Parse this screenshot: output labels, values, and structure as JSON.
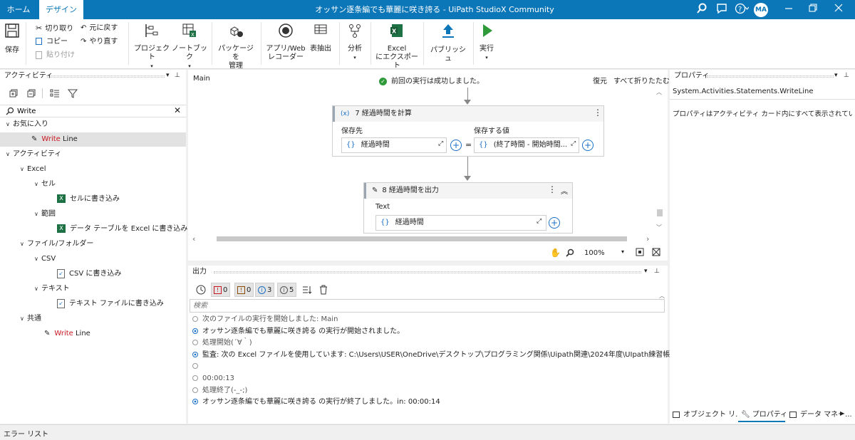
{
  "titlebar": {
    "tab_home": "ホーム",
    "tab_design": "デザイン",
    "title": "オッサン逐条編でも華麗に咲き誇る - UiPath StudioX Community",
    "avatar": "MA",
    "accent": "#0b76b8"
  },
  "ribbon": {
    "save": "保存",
    "cut": "切り取り",
    "copy": "コピー",
    "paste": "貼り付け",
    "undo": "元に戻す",
    "redo": "やり直す",
    "project": "プロジェクト",
    "notebook": "ノートブック",
    "package_l1": "パッケージを",
    "package_l2": "管理",
    "recorder_l1": "アプリ/Web",
    "recorder_l2": "レコーダー",
    "table_extract": "表抽出",
    "analyze": "分析",
    "excel_l1": "Excel",
    "excel_l2": "にエクスポート",
    "publish": "パブリッシュ",
    "run": "実行"
  },
  "activities": {
    "title": "アクティビティ",
    "search_value": "Write",
    "tree": [
      {
        "label": "お気に入り",
        "indent": 0,
        "type": "group"
      },
      {
        "label_red": "Write",
        "label_rest": " Line",
        "indent": 2,
        "type": "item",
        "selected": true
      },
      {
        "label": "アクティビティ",
        "indent": 0,
        "type": "group"
      },
      {
        "label": "Excel",
        "indent": 1,
        "type": "group"
      },
      {
        "label": "セル",
        "indent": 2,
        "type": "group"
      },
      {
        "label": "セルに書き込み",
        "indent": 3,
        "type": "excel"
      },
      {
        "label": "範囲",
        "indent": 2,
        "type": "group"
      },
      {
        "label": "データ テーブルを Excel に書き込み",
        "indent": 3,
        "type": "excel"
      },
      {
        "label": "ファイル/フォルダー",
        "indent": 1,
        "type": "group"
      },
      {
        "label": "CSV",
        "indent": 2,
        "type": "group"
      },
      {
        "label": "CSV に書き込み",
        "indent": 3,
        "type": "file"
      },
      {
        "label": "テキスト",
        "indent": 2,
        "type": "group"
      },
      {
        "label": "テキスト ファイルに書き込み",
        "indent": 3,
        "type": "file"
      },
      {
        "label": "共通",
        "indent": 1,
        "type": "group"
      },
      {
        "label_red": "Write",
        "label_rest": " Line",
        "indent": 3,
        "type": "item"
      }
    ]
  },
  "designer": {
    "breadcrumb": "Main",
    "status": "前回の実行は成功しました。",
    "restore": "復元",
    "collapse_all": "すべて折りたたむ",
    "card1": {
      "title": "7 経過時間を計算",
      "save_to_label": "保存先",
      "value_label": "保存する値",
      "save_to_value": "経過時間",
      "value_value": "(終了時間 - 開始時間..."
    },
    "card2": {
      "title": "8 経過時間を出力",
      "text_label": "Text",
      "text_value": "経過時間"
    },
    "zoom": "100%"
  },
  "output": {
    "title": "出力",
    "filters": [
      {
        "icon": "!",
        "count": "0",
        "color": "#c8161e"
      },
      {
        "icon": "!",
        "count": "0",
        "color": "#8a4b00"
      },
      {
        "icon": "i",
        "count": "3",
        "color": "#1a6fc6"
      },
      {
        "icon": "i",
        "count": "5",
        "color": "#555555"
      }
    ],
    "search_placeholder": "検索",
    "lines": [
      {
        "text": "次のファイルの実行を開始しました: Main",
        "kind": "trace"
      },
      {
        "text": "オッサン逐条編でも華麗に咲き誇る の実行が開始されました。",
        "kind": "info"
      },
      {
        "text": "処理開始(´∀｀)",
        "kind": "trace"
      },
      {
        "text": "監査: 次の Excel ファイルを使用しています: C:\\Users\\USER\\OneDrive\\デスクトップ\\プログラミング関係\\Uipath関連\\2024年度\\UIpath練習帳.xlsx",
        "kind": "info"
      },
      {
        "text": "",
        "kind": "trace"
      },
      {
        "text": "00:00:13",
        "kind": "trace"
      },
      {
        "text": "処理終了(-_-;)",
        "kind": "trace"
      },
      {
        "text": "オッサン逐条編でも華麗に咲き誇る の実行が終了しました。in: 00:00:14",
        "kind": "info"
      }
    ]
  },
  "properties": {
    "title": "プロパティ",
    "class_name": "System.Activities.Statements.WriteLine",
    "message": "プロパティはアクティビティ カード内にすべて表示されています。",
    "bottom_tabs": [
      "オブジェクト リ...",
      "プロパティ",
      "データ マネー..."
    ]
  },
  "statusbar": {
    "error_list": "エラー リスト"
  }
}
